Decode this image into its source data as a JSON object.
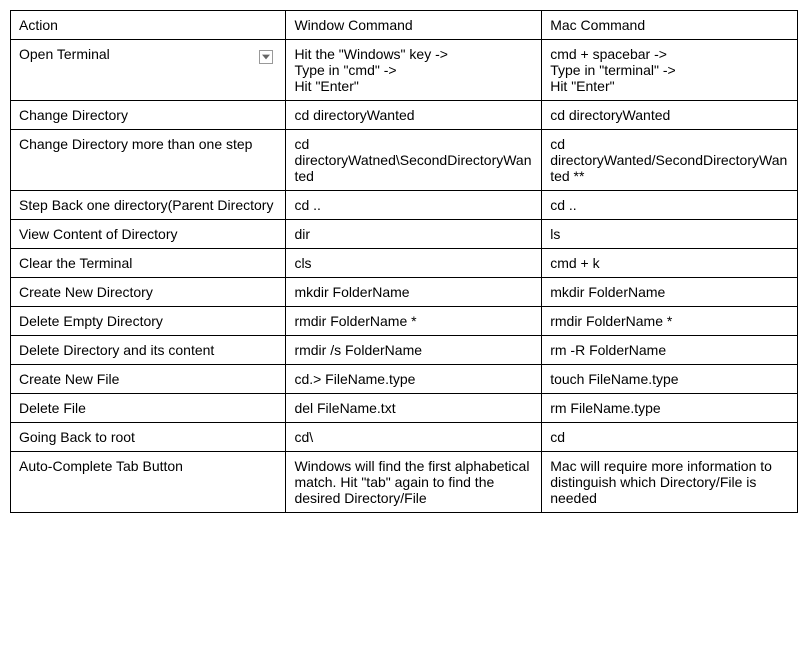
{
  "chart_data": {
    "type": "table",
    "headers": [
      "Action",
      "Window Command",
      "Mac Command"
    ],
    "rows": [
      {
        "action": "Open Terminal",
        "windows": "Hit the \"Windows\" key ->\nType in \"cmd\" ->\nHit \"Enter\"",
        "mac": "cmd +  spacebar ->\nType in \"terminal\" ->\nHit \"Enter\""
      },
      {
        "action": "Change Directory",
        "windows": "cd directoryWanted",
        "mac": "cd directoryWanted"
      },
      {
        "action": "Change Directory more than one step",
        "windows": "cd directoryWatned\\SecondDirectoryWanted",
        "mac": "cd directoryWanted/SecondDirectoryWanted **"
      },
      {
        "action": "Step Back one directory(Parent Directory",
        "windows": "cd ..",
        "mac": "cd .."
      },
      {
        "action": "View Content of Directory",
        "windows": "dir",
        "mac": "ls"
      },
      {
        "action": "Clear the Terminal",
        "windows": "cls",
        "mac": "cmd + k"
      },
      {
        "action": "Create New Directory",
        "windows": "mkdir FolderName",
        "mac": "mkdir FolderName"
      },
      {
        "action": "Delete Empty Directory",
        "windows": "rmdir FolderName *",
        "mac": "rmdir FolderName *"
      },
      {
        "action": "Delete Directory and its content",
        "windows": "rmdir /s FolderName",
        "mac": "rm -R FolderName"
      },
      {
        "action": "Create New File",
        "windows": "cd.> FileName.type",
        "mac": "touch FileName.type"
      },
      {
        "action": "Delete File",
        "windows": "del FileName.txt",
        "mac": "rm FileName.type"
      },
      {
        "action": "Going Back to root",
        "windows": "cd\\",
        "mac": "cd"
      },
      {
        "action": "Auto-Complete Tab Button",
        "windows": "Windows will find the first alphabetical match. Hit \"tab\" again to find the desired Directory/File",
        "mac": "Mac will require more information to distinguish which Directory/File is needed"
      }
    ]
  }
}
